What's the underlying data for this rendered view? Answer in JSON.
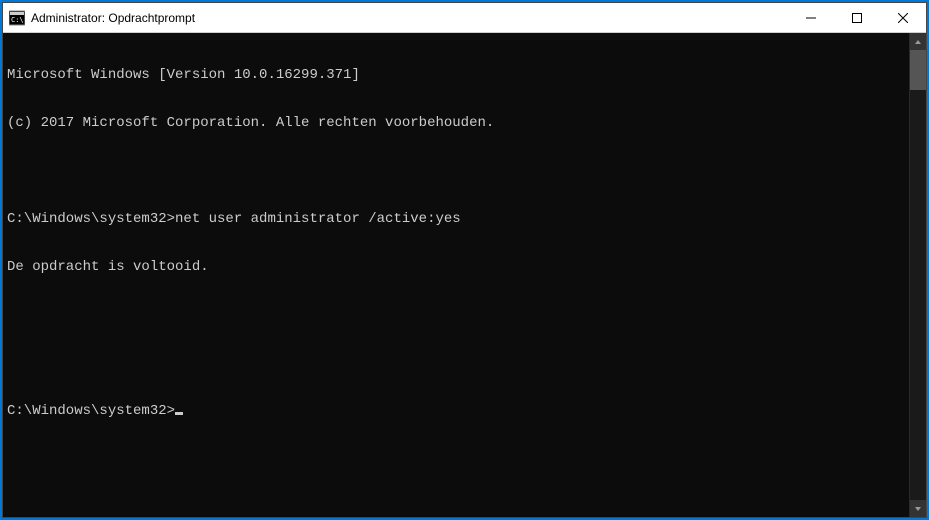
{
  "window": {
    "title": "Administrator: Opdrachtprompt"
  },
  "terminal": {
    "lines": [
      "Microsoft Windows [Version 10.0.16299.371]",
      "(c) 2017 Microsoft Corporation. Alle rechten voorbehouden.",
      "",
      "C:\\Windows\\system32>net user administrator /active:yes",
      "De opdracht is voltooid.",
      "",
      "",
      "C:\\Windows\\system32>"
    ]
  }
}
